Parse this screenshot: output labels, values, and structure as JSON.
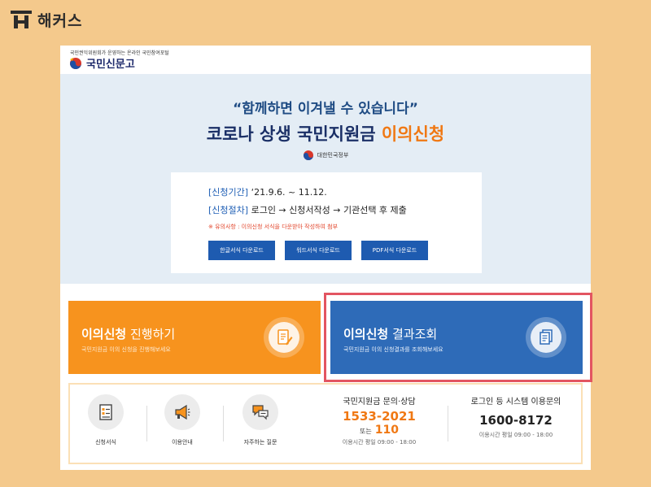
{
  "brand": {
    "name": "해커스"
  },
  "portal": {
    "subtitle": "국민권익위원회가 운영하는 온라인 국민참여포털",
    "logo_text": "국민신문고"
  },
  "hero": {
    "quote": "“함께하면 이겨낼 수 있습니다”",
    "title_main": "코로나 상생 국민지원금 ",
    "title_accent": "이의신청",
    "gov_label": "대한민국정부"
  },
  "info": {
    "period_key": "[신청기간]",
    "period_value": " ‘21.9.6. ~ 11.12.",
    "process_key": "[신청절차]",
    "process_value": " 로그인 → 신청서작성 → 기관선택 후 제출",
    "note": "※ 유의사항 : 이의신청 서식을 다운받아 작성하여 첨부",
    "downloads": [
      "한글서식 다운로드",
      "워드서식 다운로드",
      "PDF서식 다운로드"
    ]
  },
  "cards": {
    "apply": {
      "title_bold": "이의신청",
      "title_rest": " 진행하기",
      "subtitle": "국민지원금 이의 신청을 진행해보세요",
      "icon": "document-pen-icon"
    },
    "result": {
      "title_bold": "이의신청",
      "title_rest": " 결과조회",
      "subtitle": "국민지원금 이의 신청결과를 조회해보세요",
      "icon": "documents-icon"
    }
  },
  "services": [
    {
      "label": "신청서식",
      "icon": "form-checklist-icon"
    },
    {
      "label": "이용안내",
      "icon": "megaphone-icon"
    },
    {
      "label": "자주하는 질문",
      "icon": "chat-bubbles-icon"
    }
  ],
  "contacts": {
    "support": {
      "title": "국민지원금 문의·상담",
      "phone": "1533-2021",
      "or_label": "또는",
      "alt_phone": "110",
      "hours": "이용시간 평일 09:00 - 18:00"
    },
    "system": {
      "title": "로그인 등 시스템 이용문의",
      "phone": "1600-8172",
      "hours": "이용시간 평일 09:00 - 18:00"
    }
  },
  "colors": {
    "background": "#f4c98c",
    "orange": "#f7931e",
    "blue": "#2e6bb8",
    "navy": "#1a2f66",
    "highlight": "#e35561"
  }
}
